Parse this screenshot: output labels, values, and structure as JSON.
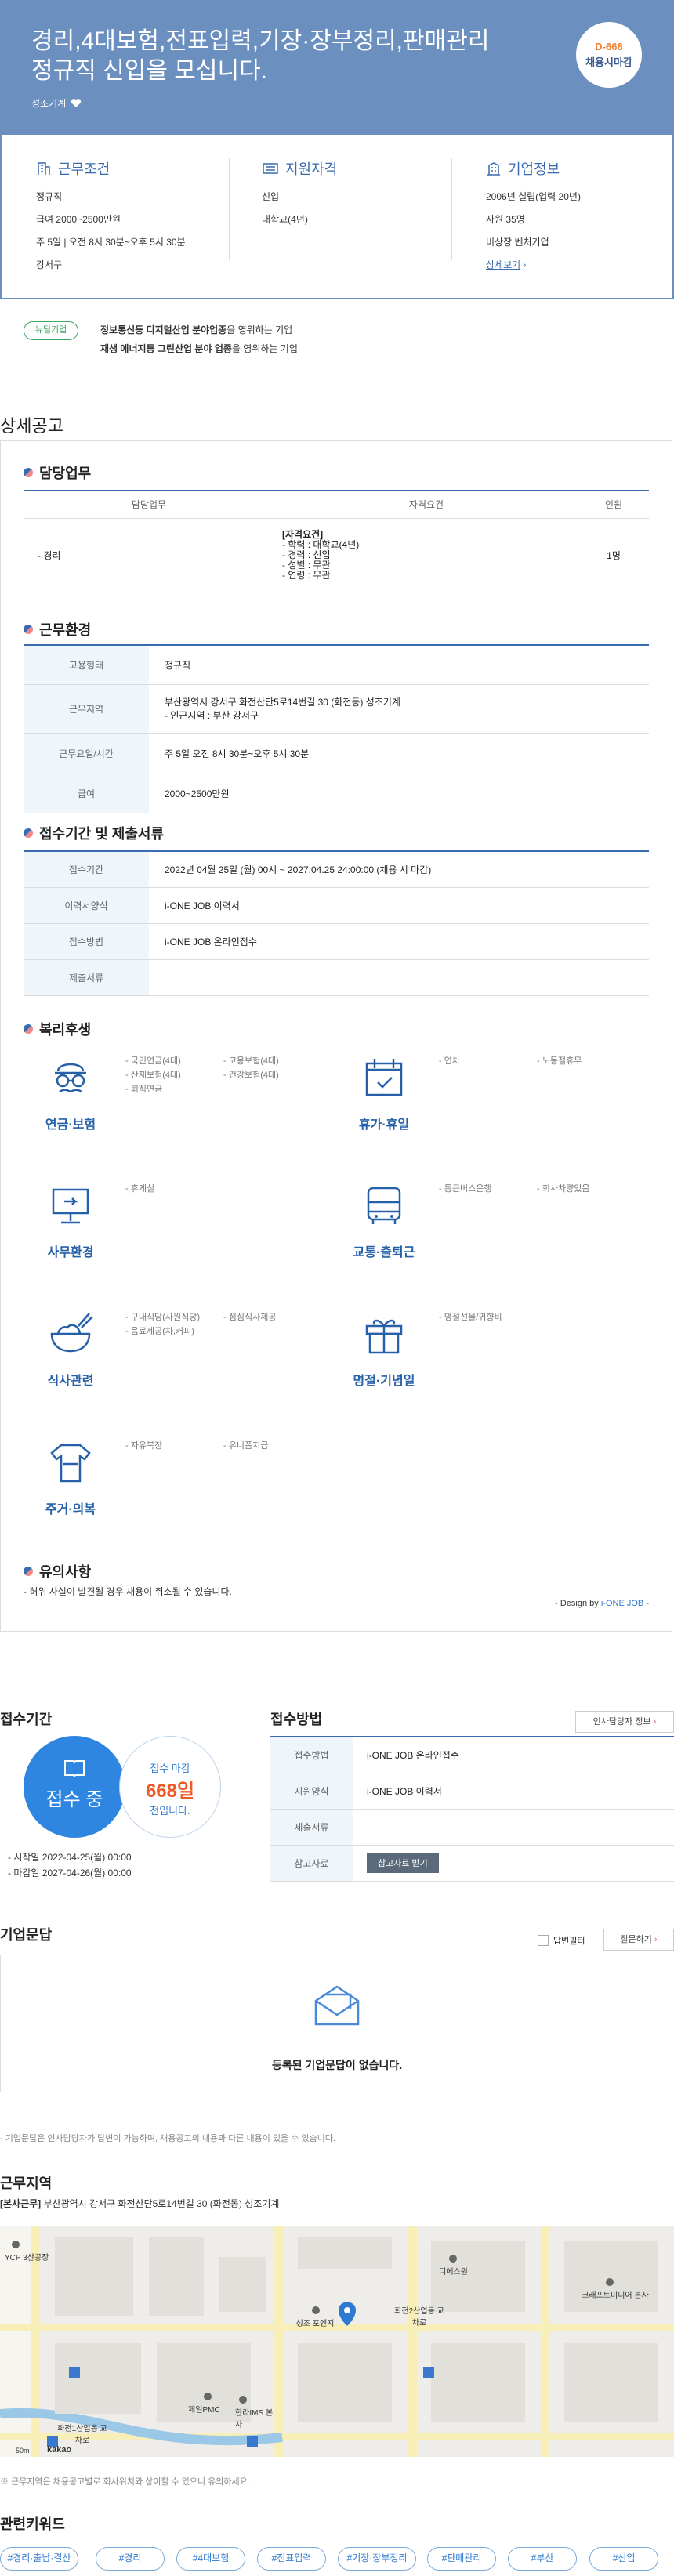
{
  "header": {
    "title_line1": "경리,4대보험,전표입력,기장·장부정리,판매관리",
    "title_line2": "정규직 신입을 모십니다.",
    "company": "성조기계",
    "dday_count": "D-668",
    "dday_label": "채용시마감"
  },
  "summary": {
    "conditions": {
      "title": "근무조건",
      "lines": [
        "정규직",
        "급여 2000~2500만원",
        "주 5일 | 오전 8시 30분~오후 5시 30분",
        "강서구"
      ]
    },
    "qualifications": {
      "title": "지원자격",
      "lines": [
        "신입",
        "대학교(4년)"
      ]
    },
    "company": {
      "title": "기업정보",
      "lines": [
        "2006년 설립(업력 20년)",
        "사원 35명",
        "비상장 벤처기업"
      ],
      "link": "상세보기"
    }
  },
  "tags": {
    "pill": "뉴딜기업",
    "line1_bold": "정보통신등 디지털산업 분야업종",
    "line1_rest": "을 영위하는 기업",
    "line2_bold": "재생 에너지등 그린산업 분야 업종",
    "line2_rest": "을 영위하는 기업"
  },
  "detail": {
    "title": "상세공고",
    "duty": {
      "title": "담당업무",
      "headers": [
        "담당업무",
        "자격요건",
        "인원"
      ],
      "row": {
        "task": "- 경리",
        "req_head": "[자격요건]",
        "req_lines": [
          "- 학력 : 대학교(4년)",
          "- 경력 : 신입",
          "- 성별 : 무관",
          "- 연령 : 무관"
        ],
        "count": "1명"
      }
    },
    "env": {
      "title": "근무환경",
      "rows": [
        {
          "k": "고용형태",
          "v": "정규직"
        },
        {
          "k": "근무지역",
          "v": "부산광역시 강서구 화전산단5로14번길 30 (화전동) 성조기계",
          "v2": "- 인근지역 : 부산 강서구"
        },
        {
          "k": "근무요일/시간",
          "v": "주 5일 오전 8시 30분~오후 5시 30분"
        },
        {
          "k": "급여",
          "v": "2000~2500만원"
        }
      ]
    },
    "apply": {
      "title": "접수기간 및 제출서류",
      "rows": [
        {
          "k": "접수기간",
          "v": "2022년 04월 25일 (월) 00시 ~ 2027.04.25 24:00:00 (채용 시 마감)"
        },
        {
          "k": "이력서양식",
          "v": "i-ONE JOB 이력서"
        },
        {
          "k": "접수방법",
          "v": "i-ONE JOB 온라인접수"
        },
        {
          "k": "제출서류",
          "v": ""
        }
      ]
    },
    "welfare": {
      "title": "복리후생",
      "items": [
        {
          "name": "연금·보험",
          "list": [
            "- 국민연금(4대)",
            "- 고용보험(4대)",
            "- 산재보험(4대)",
            "- 건강보험(4대)",
            "- 퇴직연금"
          ]
        },
        {
          "name": "휴가·휴일",
          "list": [
            "- 연차",
            "- 노동절휴무"
          ]
        },
        {
          "name": "사무환경",
          "list": [
            "- 휴게실"
          ]
        },
        {
          "name": "교통·출퇴근",
          "list": [
            "- 통근버스운행",
            "- 회사차량있음"
          ]
        },
        {
          "name": "식사관련",
          "list": [
            "- 구내식당(사원식당)",
            "- 점심식사제공",
            "- 음료제공(차,커피)"
          ]
        },
        {
          "name": "명절·기념일",
          "list": [
            "- 명절선물/귀향비"
          ]
        },
        {
          "name": "주거·의복",
          "list": [
            "- 자유복장",
            "- 유니폼지급"
          ]
        }
      ]
    },
    "caution": {
      "title": "유의사항",
      "text": "- 허위 사실이 발견될 경우 채용이 취소될 수 있습니다.",
      "design_prefix": "- Design by ",
      "design_brand": "i-ONE JOB",
      "design_suffix": " -"
    }
  },
  "period": {
    "title": "접수기간",
    "status": "접수 중",
    "remain_label": "접수 마감",
    "remain_days": "668일",
    "remain_suffix": "전입니다.",
    "start": "- 시작일 2022-04-25(월) 00:00",
    "end": "- 마감일 2027-04-26(월) 00:00"
  },
  "method": {
    "title": "접수방법",
    "contact_btn": "인사담당자 정보",
    "rows": [
      {
        "k": "접수방법",
        "v": "i-ONE JOB 온라인접수"
      },
      {
        "k": "지원양식",
        "v": "i-ONE JOB 이력서"
      },
      {
        "k": "제출서류",
        "v": ""
      },
      {
        "k": "참고자료",
        "v": "참고자료 받기"
      }
    ]
  },
  "qa": {
    "title": "기업문답",
    "checkbox_label": "답변필터",
    "ask_btn": "질문하기",
    "empty": "등록된 기업문답이 없습니다.",
    "note": "- 기업문답은 인사담당자가 답변이 가능하며, 채용공고의 내용과 다른 내용이 있을 수 있습니다."
  },
  "location": {
    "title": "근무지역",
    "addr_bold": "[본사근무]",
    "addr": " 부산광역시 강서구 화전산단5로14번길 30 (화전동) 성조기계",
    "map_labels": [
      "YCP 3산공장",
      "디에스원",
      "크래프트미디어 본사",
      "성조 포엔지",
      "화전2산업동 교차로",
      "제일PMC",
      "한라IMS 본사",
      "화전1산업동 교차로"
    ],
    "scale": "50m",
    "brand": "kakao",
    "note": "※ 근무지역은 채용공고별로 회사위치와 상이할 수 있으니 유의하세요."
  },
  "keywords": {
    "title": "관련키워드",
    "items": [
      "#경리·출납·결산",
      "#경리",
      "#4대보험",
      "#전표입력",
      "#기장·장부정리",
      "#판매관리",
      "#부산",
      "#신입"
    ]
  }
}
